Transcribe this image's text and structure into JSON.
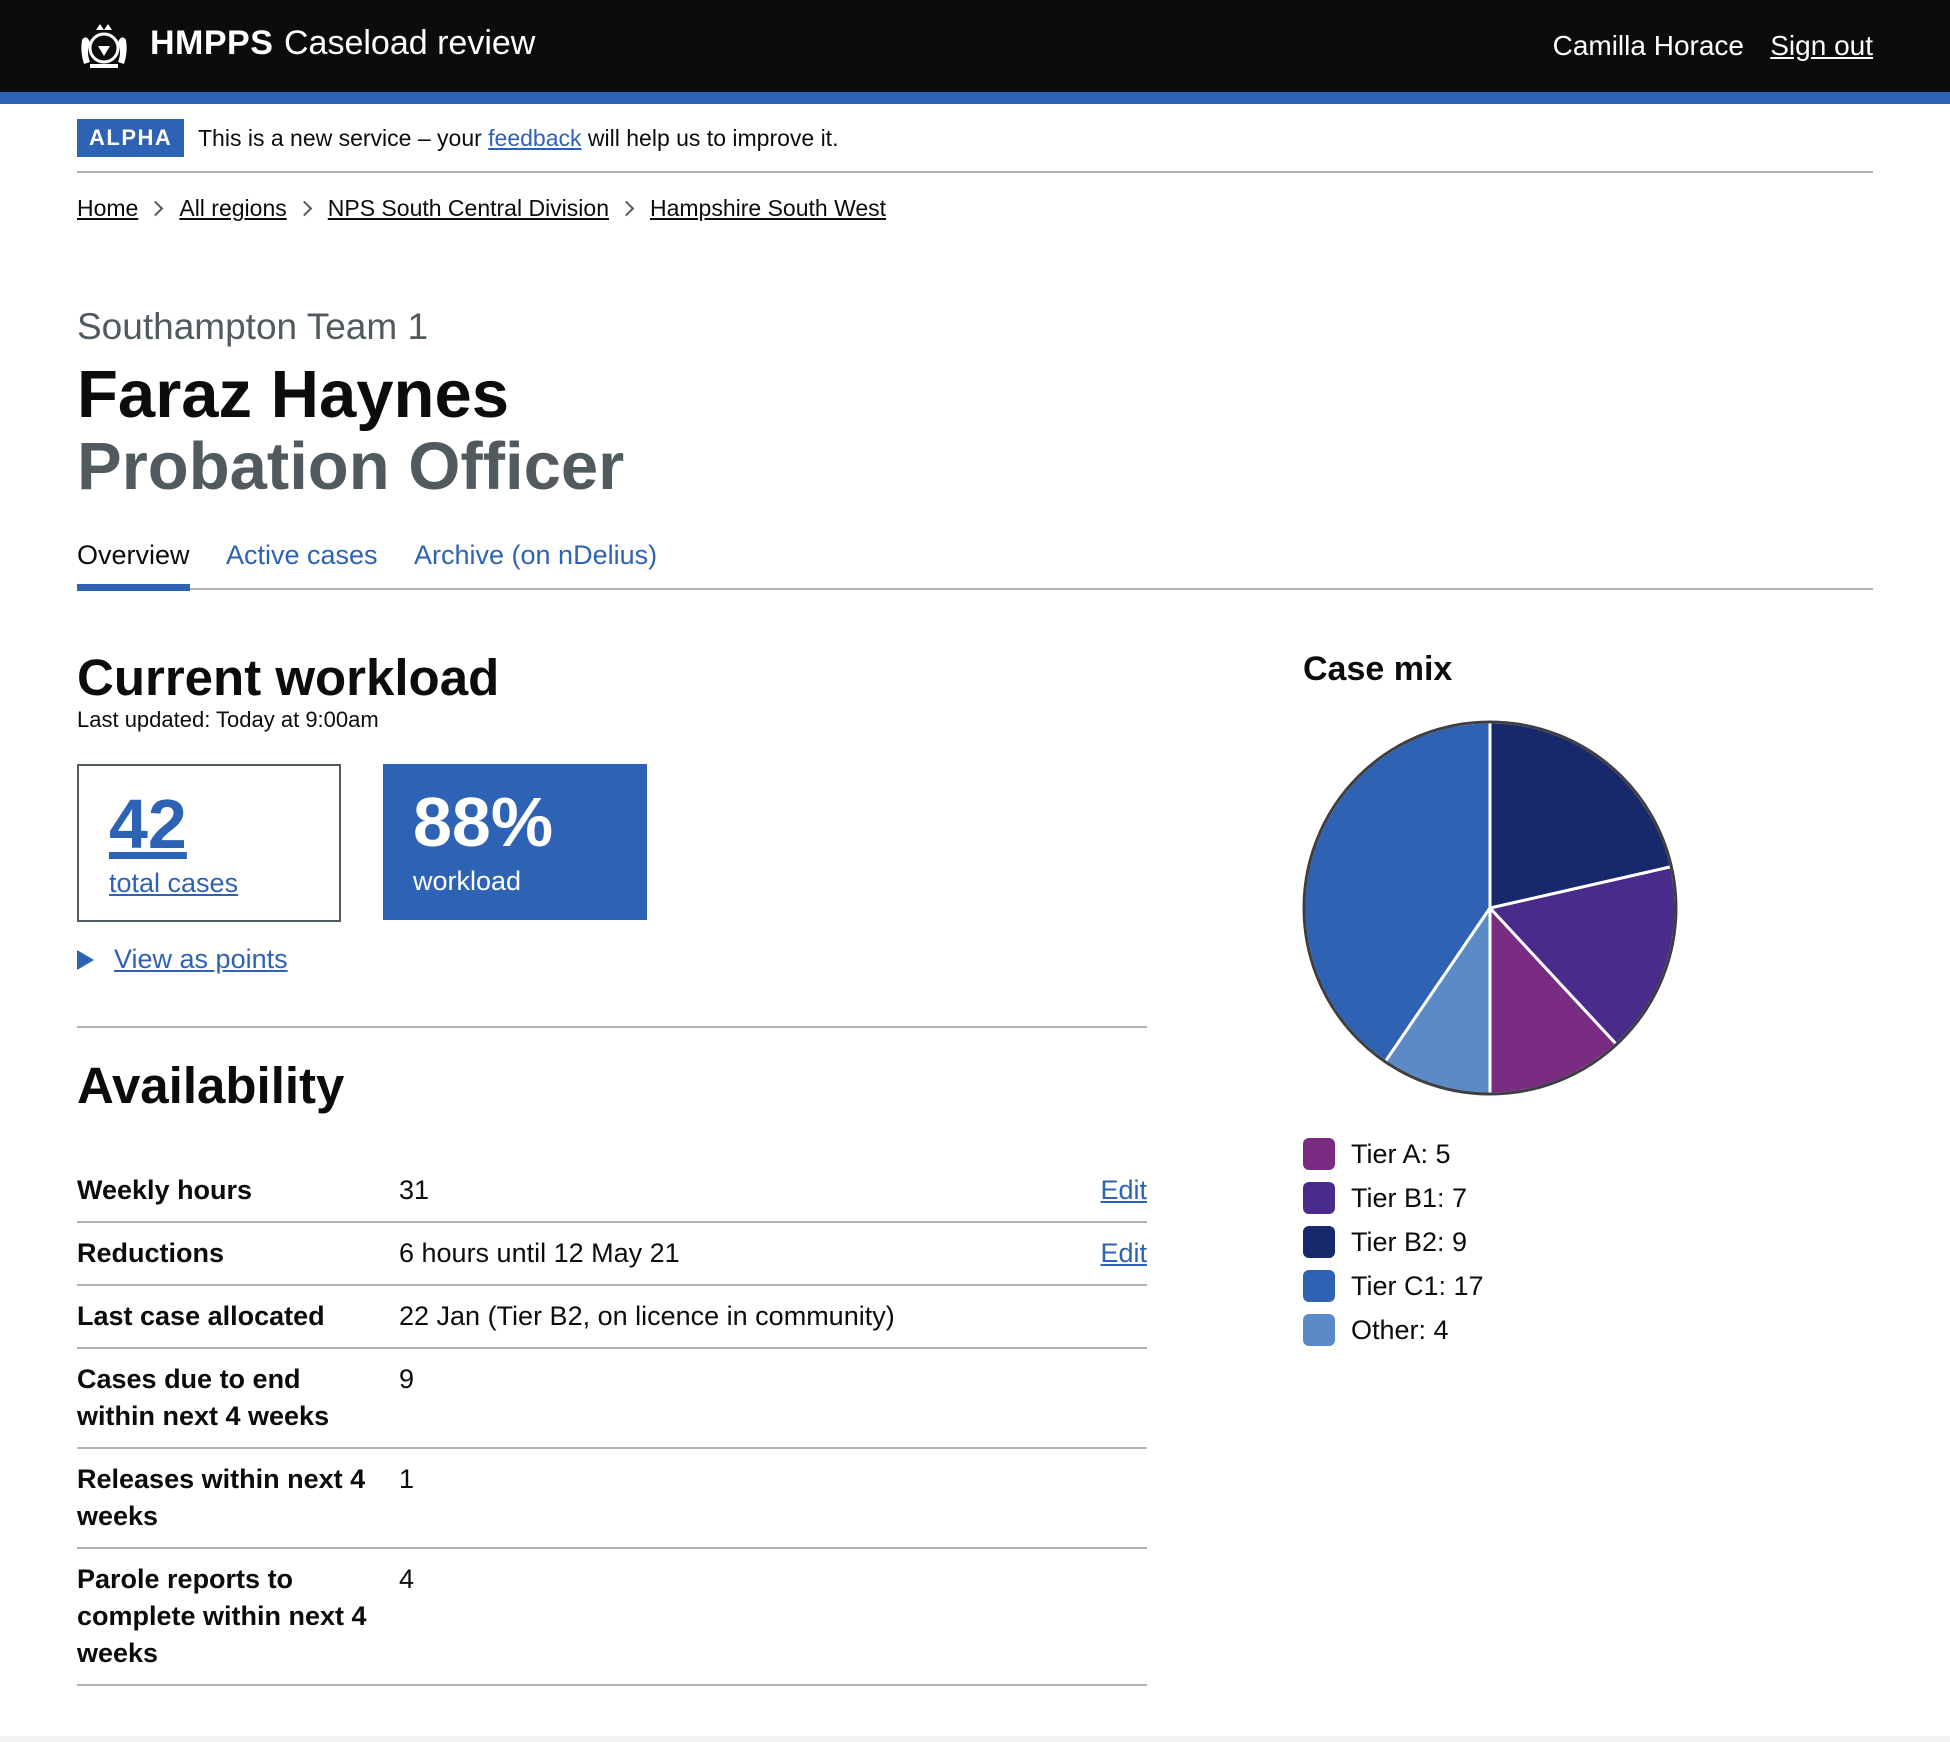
{
  "header": {
    "brand": "HMPPS",
    "service_name": "Caseload review",
    "user_name": "Camilla Horace",
    "sign_out": "Sign out"
  },
  "phase_banner": {
    "tag": "ALPHA",
    "text_before": "This is a new service – your ",
    "link": "feedback",
    "text_after": " will help us to improve it."
  },
  "breadcrumbs": [
    {
      "label": "Home"
    },
    {
      "label": "All regions"
    },
    {
      "label": "NPS South Central Division"
    },
    {
      "label": "Hampshire South West"
    }
  ],
  "heading": {
    "caption": "Southampton Team 1",
    "name": "Faraz Haynes",
    "role": "Probation Officer"
  },
  "tabs": [
    {
      "label": "Overview",
      "active": true
    },
    {
      "label": "Active cases",
      "active": false
    },
    {
      "label": "Archive (on nDelius)",
      "active": false
    }
  ],
  "workload": {
    "title": "Current workload",
    "last_updated": "Last updated: Today at 9:00am",
    "total_cases_value": "42",
    "total_cases_label": "total cases",
    "workload_value": "88%",
    "workload_label": "workload",
    "details_link": "View as points"
  },
  "availability": {
    "title": "Availability",
    "rows": [
      {
        "key": "Weekly hours",
        "value": "31",
        "action": "Edit"
      },
      {
        "key": "Reductions",
        "value": "6 hours until 12 May 21",
        "action": "Edit"
      },
      {
        "key": "Last case allocated",
        "value": "22 Jan (Tier B2, on licence in community)",
        "action": ""
      },
      {
        "key": "Cases due to end within next 4 weeks",
        "value": "9",
        "action": ""
      },
      {
        "key": "Releases within next 4 weeks",
        "value": "1",
        "action": ""
      },
      {
        "key": "Parole reports to complete within next 4 weeks",
        "value": "4",
        "action": ""
      }
    ]
  },
  "chart_data": {
    "type": "pie",
    "title": "Case mix",
    "legend_position": "bottom",
    "slices": [
      {
        "label": "Tier A",
        "value": 5,
        "color": "#7a2c82",
        "legend": "Tier A: 5"
      },
      {
        "label": "Tier B1",
        "value": 7,
        "color": "#4a2a8a",
        "legend": "Tier B1: 7"
      },
      {
        "label": "Tier B2",
        "value": 9,
        "color": "#17296b",
        "legend": "Tier B2: 9"
      },
      {
        "label": "Tier C1",
        "value": 17,
        "color": "#2f62b3",
        "legend": "Tier C1: 17"
      },
      {
        "label": "Other",
        "value": 4,
        "color": "#5b8ac6",
        "legend": "Other: 4"
      }
    ]
  },
  "colors": {
    "header_bg": "#0b0c0c",
    "accent": "#2e62b5",
    "secondary_text": "#505a5f"
  }
}
